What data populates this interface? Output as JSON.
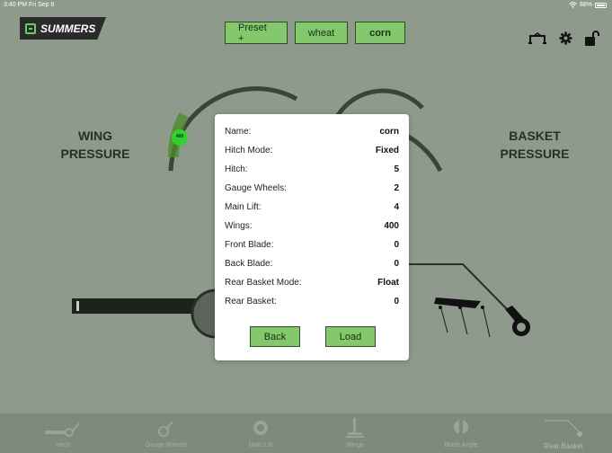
{
  "status": {
    "time": "3:40 PM  Fri Sep 6",
    "battery": "88%"
  },
  "logo": {
    "text": "SUMMERS"
  },
  "presets": [
    {
      "label": "Preset +"
    },
    {
      "label": "wheat"
    },
    {
      "label": "corn"
    }
  ],
  "icons": {
    "toolbar": [
      "hitch-link-icon",
      "gear-icon",
      "unlock-icon"
    ]
  },
  "gauges": {
    "wing": {
      "label_line1": "WING",
      "label_line2": "PRESSURE",
      "value": "400"
    },
    "basket": {
      "label_line1": "BASKET",
      "label_line2": "PRESSURE"
    }
  },
  "preset_details": {
    "rows": [
      {
        "label": "Name:",
        "value": "corn"
      },
      {
        "label": "Hitch Mode:",
        "value": "Fixed"
      },
      {
        "label": "Hitch:",
        "value": "5"
      },
      {
        "label": "Gauge Wheels:",
        "value": "2"
      },
      {
        "label": "Main Lift:",
        "value": "4"
      },
      {
        "label": "Wings:",
        "value": "400"
      },
      {
        "label": "Front Blade:",
        "value": "0"
      },
      {
        "label": "Back Blade:",
        "value": "0"
      },
      {
        "label": "Rear Basket Mode:",
        "value": "Float"
      },
      {
        "label": "Rear Basket:",
        "value": "0"
      }
    ],
    "back_label": "Back",
    "load_label": "Load"
  },
  "bottom_nav": [
    {
      "label": "Hitch"
    },
    {
      "label": "Gauge Wheels"
    },
    {
      "label": "Main Lift"
    },
    {
      "label": "Wings"
    },
    {
      "label": "Blade Angle"
    },
    {
      "label": "Rear Basket"
    }
  ],
  "colors": {
    "accent": "#83c86c",
    "background": "#8e9a8c",
    "gauge_highlight": "#2fd12f"
  }
}
